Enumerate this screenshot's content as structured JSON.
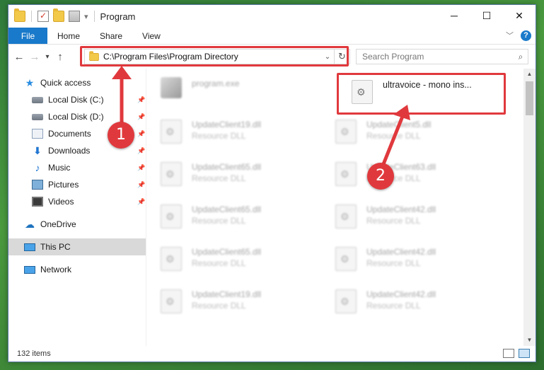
{
  "window": {
    "title": "Program",
    "controls": {
      "minimize": "─",
      "maximize": "☐",
      "close": "✕"
    }
  },
  "ribbon": {
    "tabs": [
      "File",
      "Home",
      "Share",
      "View"
    ]
  },
  "navigation": {
    "address": "C:\\Program Files\\Program Directory",
    "search_placeholder": "Search Program"
  },
  "sidebar": {
    "items": [
      {
        "label": "Quick access",
        "icon": "star-icon"
      },
      {
        "label": "Local Disk (C:)",
        "icon": "disk-icon",
        "pinned": true
      },
      {
        "label": "Local Disk (D:)",
        "icon": "disk-icon",
        "pinned": true
      },
      {
        "label": "Documents",
        "icon": "documents-icon",
        "pinned": true
      },
      {
        "label": "Downloads",
        "icon": "download-icon",
        "pinned": true
      },
      {
        "label": "Music",
        "icon": "music-icon",
        "pinned": true
      },
      {
        "label": "Pictures",
        "icon": "pictures-icon",
        "pinned": true
      },
      {
        "label": "Videos",
        "icon": "videos-icon",
        "pinned": true
      },
      {
        "label": "OneDrive",
        "icon": "cloud-icon"
      },
      {
        "label": "This PC",
        "icon": "pc-icon",
        "selected": true
      },
      {
        "label": "Network",
        "icon": "network-icon"
      }
    ]
  },
  "files": {
    "highlighted": {
      "name": "ultravoice - mono ins..."
    },
    "exe": {
      "name": "program.exe"
    },
    "left_column": [
      {
        "name": "UpdateClient19.dll",
        "desc": "Resource DLL"
      },
      {
        "name": "UpdateClient65.dll",
        "desc": "Resource DLL"
      },
      {
        "name": "UpdateClient65.dll",
        "desc": "Resource DLL"
      },
      {
        "name": "UpdateClient65.dll",
        "desc": "Resource DLL"
      },
      {
        "name": "UpdateClient19.dll",
        "desc": "Resource DLL"
      }
    ],
    "right_column": [
      {
        "name": "UpdateClient5.dll",
        "desc": "Resource DLL"
      },
      {
        "name": "UpdateClient63.dll",
        "desc": "Resource DLL"
      },
      {
        "name": "UpdateClient42.dll",
        "desc": "Resource DLL"
      },
      {
        "name": "UpdateClient42.dll",
        "desc": "Resource DLL"
      },
      {
        "name": "UpdateClient42.dll",
        "desc": "Resource DLL"
      }
    ]
  },
  "status": {
    "item_count": "132 items"
  },
  "annotations": {
    "badge1": "1",
    "badge2": "2",
    "color": "#e0393d"
  }
}
